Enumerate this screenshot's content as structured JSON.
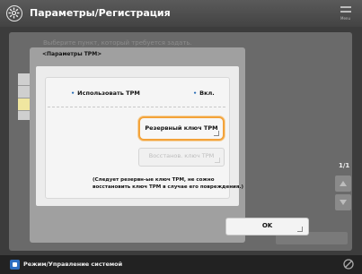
{
  "header": {
    "title": "Параметры/Регистрация",
    "menu_label": "Menu"
  },
  "background": {
    "hint_text": "Выберите пункт, который требуется задать.",
    "page_indicator": "1/1"
  },
  "dialog": {
    "title": "<Параметры TPM>",
    "status": {
      "label": "Использовать TPM",
      "value": "Вкл."
    },
    "buttons": {
      "backup": "Резервный ключ TPM",
      "restore": "Восстанов. ключ TPM",
      "ok": "OK"
    },
    "note": "(Следует резервн-ые ключ TPM, не сожно восстановить ключ TPM в случае его повреждения.)"
  },
  "statusbar": {
    "text": "Режим/Управление системой"
  },
  "colors": {
    "accent_orange": "#f3a33b",
    "status_icon_blue": "#2f6fc1"
  }
}
